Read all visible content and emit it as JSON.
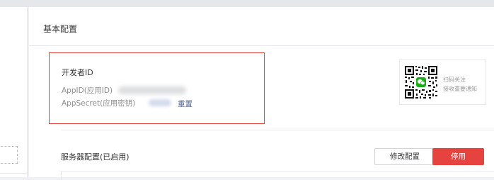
{
  "page": {
    "section_title": "基本配置"
  },
  "developer": {
    "heading": "开发者ID",
    "appid_label": "AppID(应用ID)",
    "appsecret_label": "AppSecret(应用密钥)",
    "reset_label": "重置"
  },
  "qr": {
    "line1": "扫码关注",
    "line2": "接收重要通知",
    "icon": "wechat-icon"
  },
  "server": {
    "title": "服务器配置(已启用)",
    "modify_label": "修改配置",
    "disable_label": "停用"
  },
  "colors": {
    "accent_red": "#e64340",
    "highlight_border": "#e0433a",
    "link": "#576b95",
    "wechat_green": "#1aad19"
  }
}
